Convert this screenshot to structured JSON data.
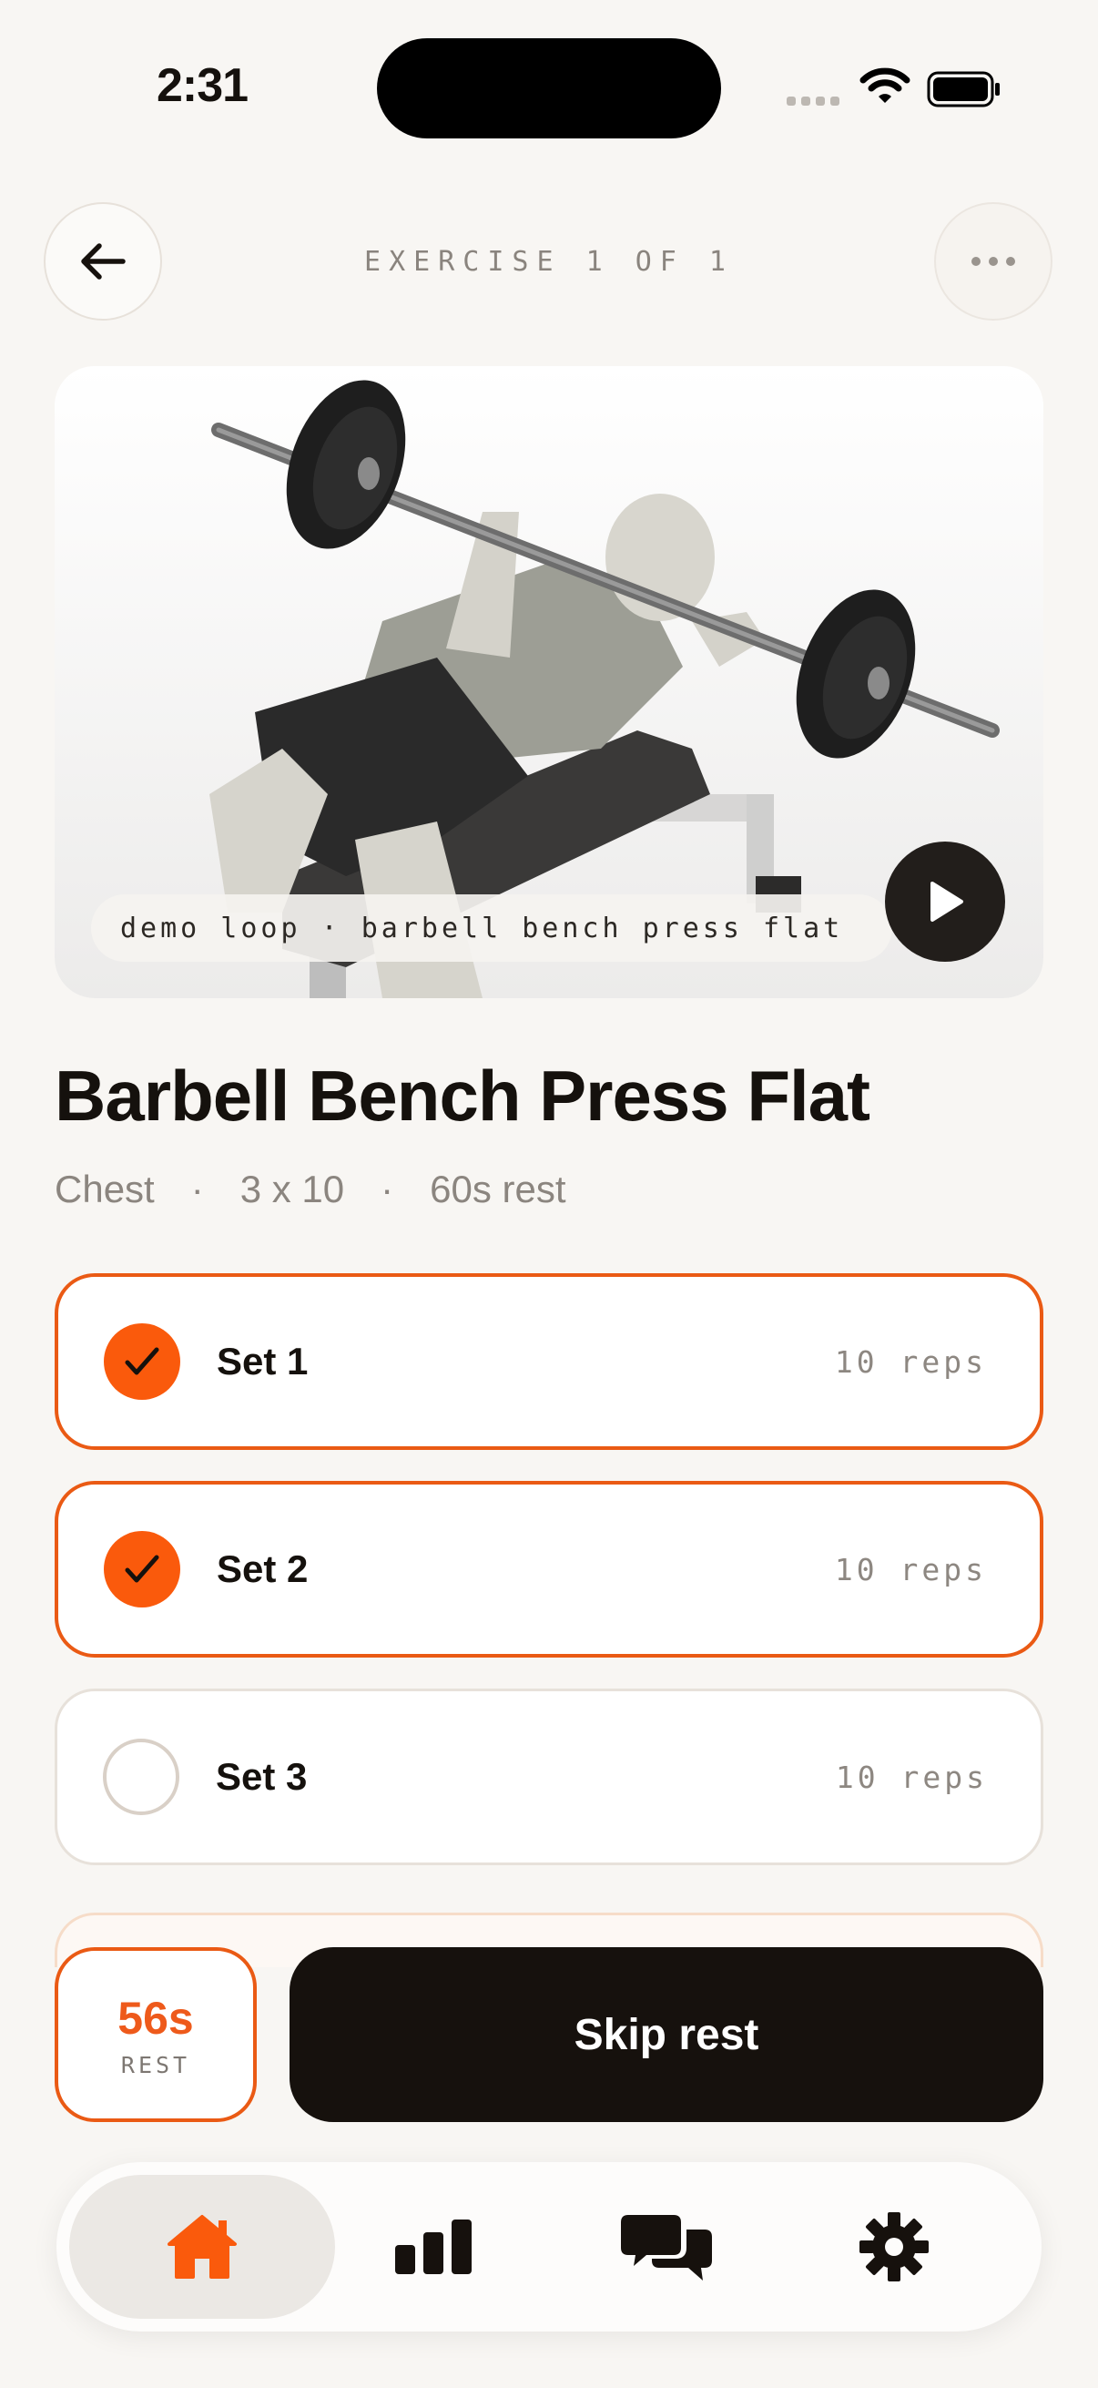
{
  "status_bar": {
    "time": "2:31"
  },
  "header": {
    "exercise_counter": "EXERCISE 1 OF 1"
  },
  "media": {
    "caption": "demo loop · barbell bench press flat"
  },
  "exercise": {
    "title": "Barbell Bench Press Flat",
    "muscle": "Chest",
    "scheme": "3 x 10",
    "rest": "60s rest",
    "separator": "·"
  },
  "sets": [
    {
      "label": "Set 1",
      "reps": "10 reps",
      "done": true
    },
    {
      "label": "Set 2",
      "reps": "10 reps",
      "done": true
    },
    {
      "label": "Set 3",
      "reps": "10 reps",
      "done": false
    }
  ],
  "rest_timer": {
    "value": "56s",
    "label": "REST"
  },
  "actions": {
    "skip_label": "Skip rest"
  },
  "tabs": [
    {
      "icon": "home-icon",
      "active": true
    },
    {
      "icon": "bar-chart-icon",
      "active": false
    },
    {
      "icon": "chat-icon",
      "active": false
    },
    {
      "icon": "gear-icon",
      "active": false
    }
  ],
  "colors": {
    "accent": "#FA5A0C",
    "dark": "#16110D",
    "background": "#F8F6F3"
  }
}
